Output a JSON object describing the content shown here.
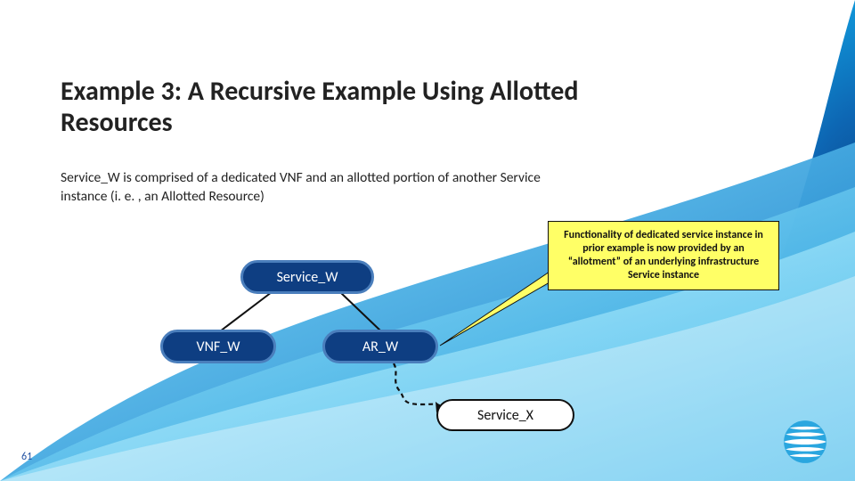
{
  "title": "Example 3: A Recursive Example Using Allotted Resources",
  "subtitle": "Service_W is comprised of a dedicated VNF and an allotted portion of another Service instance (i. e. , an Allotted Resource)",
  "callout": "Functionality of dedicated service instance in prior example is now provided by an “allotment” of an underlying infrastructure Service instance",
  "nodes": {
    "service_w": "Service_W",
    "vnf_w": "VNF_W",
    "ar_w": "AR_W",
    "service_x": "Service_X"
  },
  "page_number": "61",
  "colors": {
    "title": "#222222",
    "pill_blue_bg": "#0e3e82",
    "pill_blue_border": "#4a7ebc",
    "callout_bg": "#ffff66",
    "accent": "#1f4fa0"
  }
}
